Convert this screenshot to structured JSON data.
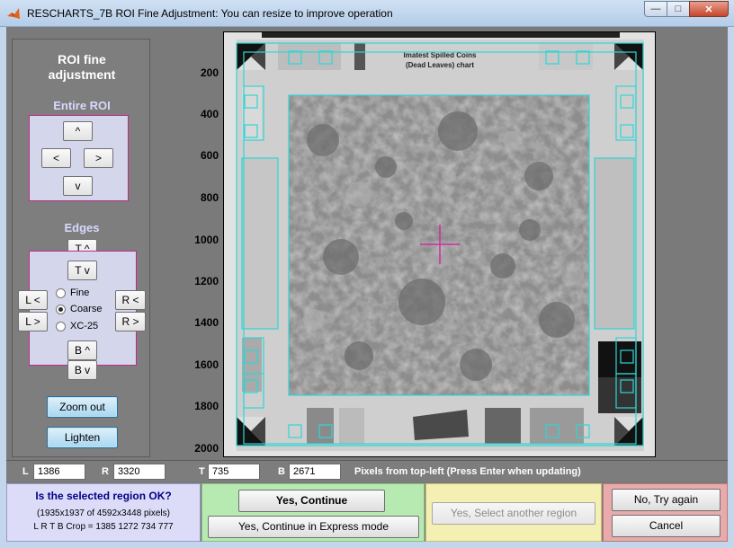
{
  "window": {
    "title": "RESCHARTS_7B ROI Fine Adjustment: You can resize to improve operation",
    "minimize": "—",
    "maximize": "□",
    "close": "✕"
  },
  "left_panel": {
    "title": "ROI fine adjustment",
    "entire_roi_label": "Entire ROI",
    "entire_roi_buttons": {
      "up": "^",
      "left": "<",
      "right": ">",
      "down": "v"
    },
    "edges_label": "Edges",
    "edge_buttons": {
      "t_up": "T ^",
      "t_down": "T v",
      "l_left": "L <",
      "l_right": "L >",
      "r_left": "R <",
      "r_right": "R >",
      "b_up": "B ^",
      "b_down": "B v"
    },
    "step_options": [
      "Fine",
      "Coarse",
      "XC-25"
    ],
    "step_selected": "Coarse",
    "zoom_out": "Zoom out",
    "lighten": "Lighten"
  },
  "plot": {
    "y_ticks": [
      "200",
      "400",
      "600",
      "800",
      "1000",
      "1200",
      "1400",
      "1600",
      "1800",
      "2000"
    ],
    "chart_title_line1": "Imatest Spilled Coins",
    "chart_title_line2": "(Dead Leaves) chart",
    "colors": {
      "roi": "#2fd6d6",
      "crosshair": "#d02aa0"
    }
  },
  "coords": {
    "L_label": "L",
    "L_value": "1386",
    "R_label": "R",
    "R_value": "3320",
    "T_label": "T",
    "T_value": "735",
    "B_label": "B",
    "B_value": "2671",
    "hint": "Pixels from top-left  (Press Enter when updating)"
  },
  "bottom": {
    "question": "Is the selected region OK?",
    "size_info": "(1935x1937 of 4592x3448 pixels)",
    "crop_info": "L R T B Crop = 1385  1272   734   777",
    "yes_continue": "Yes, Continue",
    "yes_express": "Yes, Continue in Express mode",
    "yes_select_another": "Yes, Select another region",
    "no_try_again": "No, Try again",
    "cancel": "Cancel"
  }
}
